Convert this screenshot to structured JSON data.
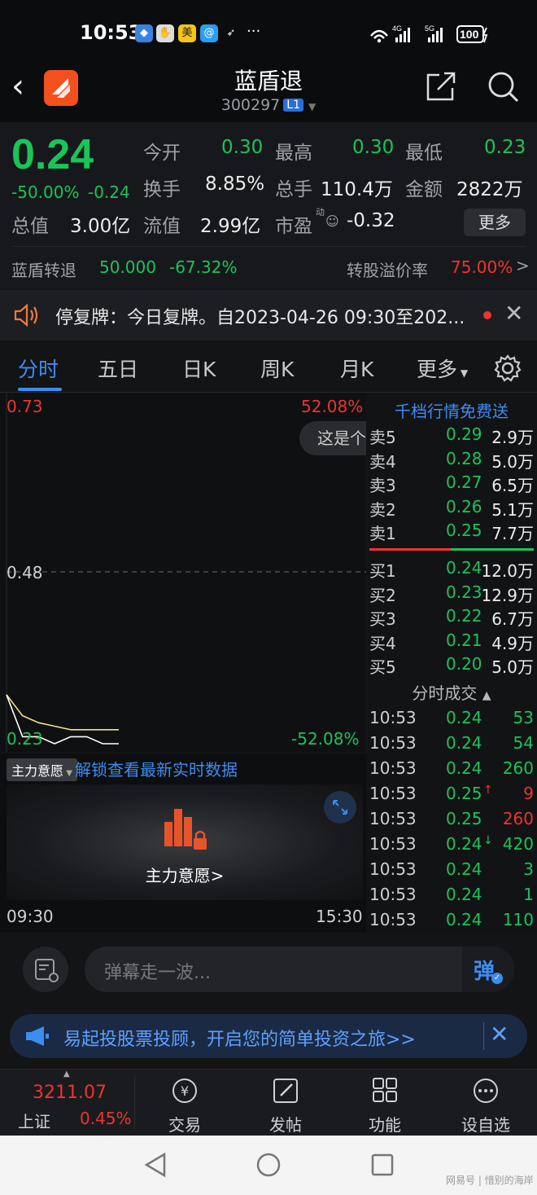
{
  "status_bar": {
    "time": "10:53",
    "right": "4G 5G 100",
    "icons": [
      "app-icon",
      "hand-icon",
      "meituan-icon",
      "browser-icon",
      "send-icon",
      "more-dots"
    ]
  },
  "header": {
    "title": "蓝盾退",
    "code": "300297",
    "level_badge": "L1"
  },
  "quote": {
    "price": "0.24",
    "change_pct": "-50.00%",
    "change": "-0.24",
    "fields": [
      {
        "label": "今开",
        "value": "0.30"
      },
      {
        "label": "最高",
        "value": "0.30"
      },
      {
        "label": "最低",
        "value": "0.23"
      },
      {
        "label": "换手",
        "value": "8.85%"
      },
      {
        "label": "总手",
        "value": "110.4万"
      },
      {
        "label": "金额",
        "value": "2822万"
      },
      {
        "label": "总值",
        "value": "3.00亿"
      },
      {
        "label": "流值",
        "value": "2.99亿"
      },
      {
        "label": "市盈",
        "value": "-0.32"
      }
    ],
    "pe_superscript": "动",
    "more_label": "更多",
    "convertible": {
      "name": "蓝盾转退",
      "price": "50.000",
      "change": "-67.32%",
      "premium_label": "转股溢价率",
      "premium": "75.00%"
    }
  },
  "notice": {
    "text": "停复牌：今日复牌。自2023-04-26 09:30至202..."
  },
  "tabs": {
    "items": [
      "分时",
      "五日",
      "日K",
      "周K",
      "月K",
      "更多"
    ],
    "active": "分时"
  },
  "chart": {
    "top_left": "0.73",
    "top_right": "52.08%",
    "mid": "0.48",
    "bottom_left": "0.23",
    "bottom_right": "-52.08%",
    "tooltip": "这是个",
    "start_time": "09:30",
    "end_time": "15:30"
  },
  "chart_data": {
    "type": "line",
    "ylim": [
      0.23,
      0.73
    ],
    "series": [
      {
        "values": [
          0.3,
          0.27,
          0.26,
          0.255,
          0.25,
          0.25,
          0.25,
          0.25
        ]
      },
      {
        "values": [
          0.3,
          0.24,
          0.24,
          0.23,
          0.24,
          0.24,
          0.23,
          0.23
        ]
      }
    ]
  },
  "orderbook": {
    "header": "千档行情免费送",
    "asks": [
      {
        "label": "卖5",
        "price": "0.29",
        "vol": "2.9万"
      },
      {
        "label": "卖4",
        "price": "0.28",
        "vol": "5.0万"
      },
      {
        "label": "卖3",
        "price": "0.27",
        "vol": "6.5万"
      },
      {
        "label": "卖2",
        "price": "0.26",
        "vol": "5.1万"
      },
      {
        "label": "卖1",
        "price": "0.25",
        "vol": "7.7万"
      }
    ],
    "bids": [
      {
        "label": "买1",
        "price": "0.24",
        "vol": "12.0万"
      },
      {
        "label": "买2",
        "price": "0.23",
        "vol": "12.9万"
      },
      {
        "label": "买3",
        "price": "0.22",
        "vol": "6.7万"
      },
      {
        "label": "买4",
        "price": "0.21",
        "vol": "4.9万"
      },
      {
        "label": "买5",
        "price": "0.20",
        "vol": "5.0万"
      }
    ],
    "trades_header": "分时成交",
    "trades": [
      {
        "time": "10:53",
        "price": "0.24",
        "arrow": "",
        "vol": "53",
        "dir": "down"
      },
      {
        "time": "10:53",
        "price": "0.24",
        "arrow": "",
        "vol": "54",
        "dir": "down"
      },
      {
        "time": "10:53",
        "price": "0.24",
        "arrow": "",
        "vol": "260",
        "dir": "down"
      },
      {
        "time": "10:53",
        "price": "0.25",
        "arrow": "↑",
        "vol": "9",
        "dir": "up"
      },
      {
        "time": "10:53",
        "price": "0.25",
        "arrow": "",
        "vol": "260",
        "dir": "up"
      },
      {
        "time": "10:53",
        "price": "0.24",
        "arrow": "↓",
        "vol": "420",
        "dir": "down"
      },
      {
        "time": "10:53",
        "price": "0.24",
        "arrow": "",
        "vol": "3",
        "dir": "down"
      },
      {
        "time": "10:53",
        "price": "0.24",
        "arrow": "",
        "vol": "1",
        "dir": "down"
      },
      {
        "time": "10:53",
        "price": "0.24",
        "arrow": "",
        "vol": "110",
        "dir": "down"
      }
    ]
  },
  "mainforce": {
    "dropdown": "主力意愿",
    "unlock": "解锁查看最新实时数据",
    "center_label": "主力意愿>"
  },
  "danmaku": {
    "placeholder": "弹幕走一波...",
    "send": "弹"
  },
  "ad": {
    "text": "易起投股票投顾，开启您的简单投资之旅>>"
  },
  "bottom": {
    "index_value": "3211.07",
    "index_name": "上证",
    "index_change": "0.45%",
    "items": [
      "交易",
      "发帖",
      "功能",
      "设自选"
    ]
  },
  "watermark": "网易号 | 惜别的海岸"
}
